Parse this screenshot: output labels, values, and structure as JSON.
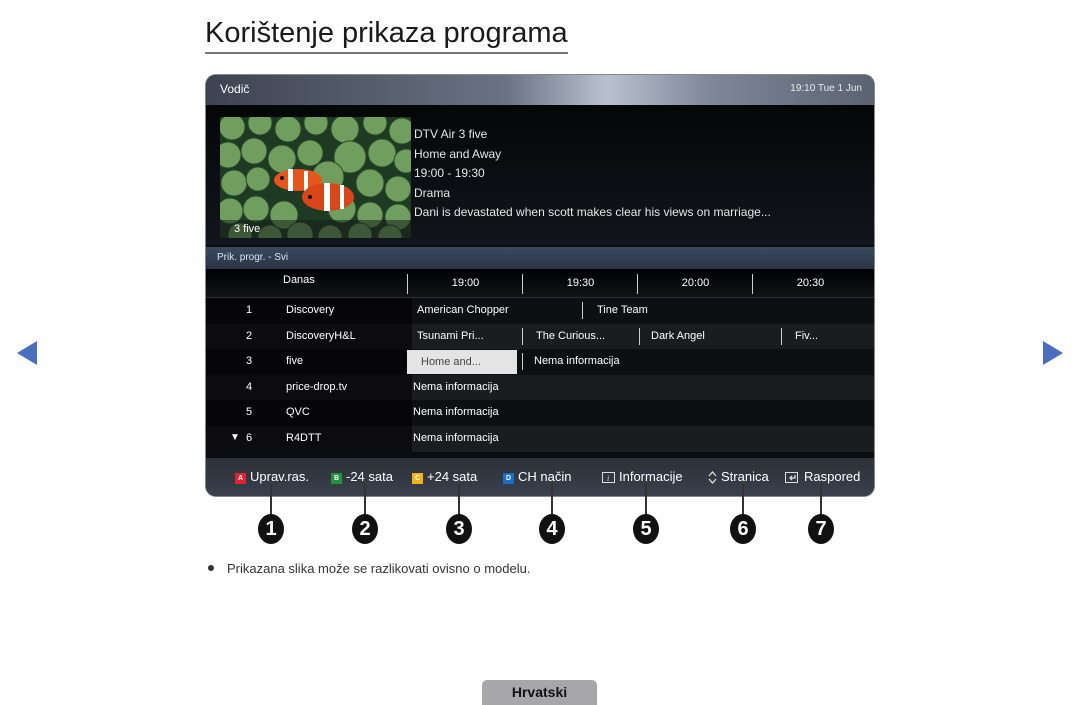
{
  "page": {
    "title": "Korištenje prikaza programa",
    "note": "Prikazana slika može se razlikovati ovisno o modelu.",
    "language_tab": "Hrvatski",
    "nav": {
      "prev_icon": "triangle-left",
      "next_icon": "triangle-right",
      "arrow_color": "#4a6fbd"
    }
  },
  "guide": {
    "title": "Vodič",
    "clock": "19:10 Tue 1 Jun",
    "preview": {
      "channel_caption": "3 five",
      "details": [
        "DTV Air 3 five",
        "Home and Away",
        "19:00 - 19:30",
        "Drama",
        "Dani is devastated when scott makes clear his views on marriage..."
      ]
    },
    "filter": "Prik. progr. - Svi",
    "time_header": {
      "day": "Danas",
      "slots": [
        "19:00",
        "19:30",
        "20:00",
        "20:30"
      ]
    },
    "channels": [
      {
        "number": "1",
        "name": "Discovery",
        "programs": [
          "American Chopper",
          "Tine Team"
        ]
      },
      {
        "number": "2",
        "name": "DiscoveryH&L",
        "programs": [
          "Tsunami Pri...",
          "The Curious...",
          "Dark Angel",
          "Fiv..."
        ]
      },
      {
        "number": "3",
        "name": "five",
        "programs": [
          "Home and...",
          "Nema informacija"
        ],
        "selected_program": "Home and..."
      },
      {
        "number": "4",
        "name": "price-drop.tv",
        "programs": [
          "Nema informacija"
        ]
      },
      {
        "number": "5",
        "name": "QVC",
        "programs": [
          "Nema informacija"
        ]
      },
      {
        "number": "6",
        "name": "R4DTT",
        "programs": [
          "Nema informacija"
        ],
        "indicator": "▼"
      }
    ],
    "footer": [
      {
        "key": "A",
        "key_color": "#e0232e",
        "label": "Uprav.ras."
      },
      {
        "key": "B",
        "key_color": "#22923b",
        "label": "-24 sata"
      },
      {
        "key": "C",
        "key_color": "#f2b318",
        "label": "+24 sata"
      },
      {
        "key": "D",
        "key_color": "#1c6fc4",
        "label": "CH način"
      },
      {
        "icon": "info-icon",
        "label": "Informacije"
      },
      {
        "icon": "page-updown-icon",
        "label": "Stranica"
      },
      {
        "icon": "schedule-icon",
        "label": "Raspored"
      }
    ]
  },
  "callouts": [
    "1",
    "2",
    "3",
    "4",
    "5",
    "6",
    "7"
  ]
}
